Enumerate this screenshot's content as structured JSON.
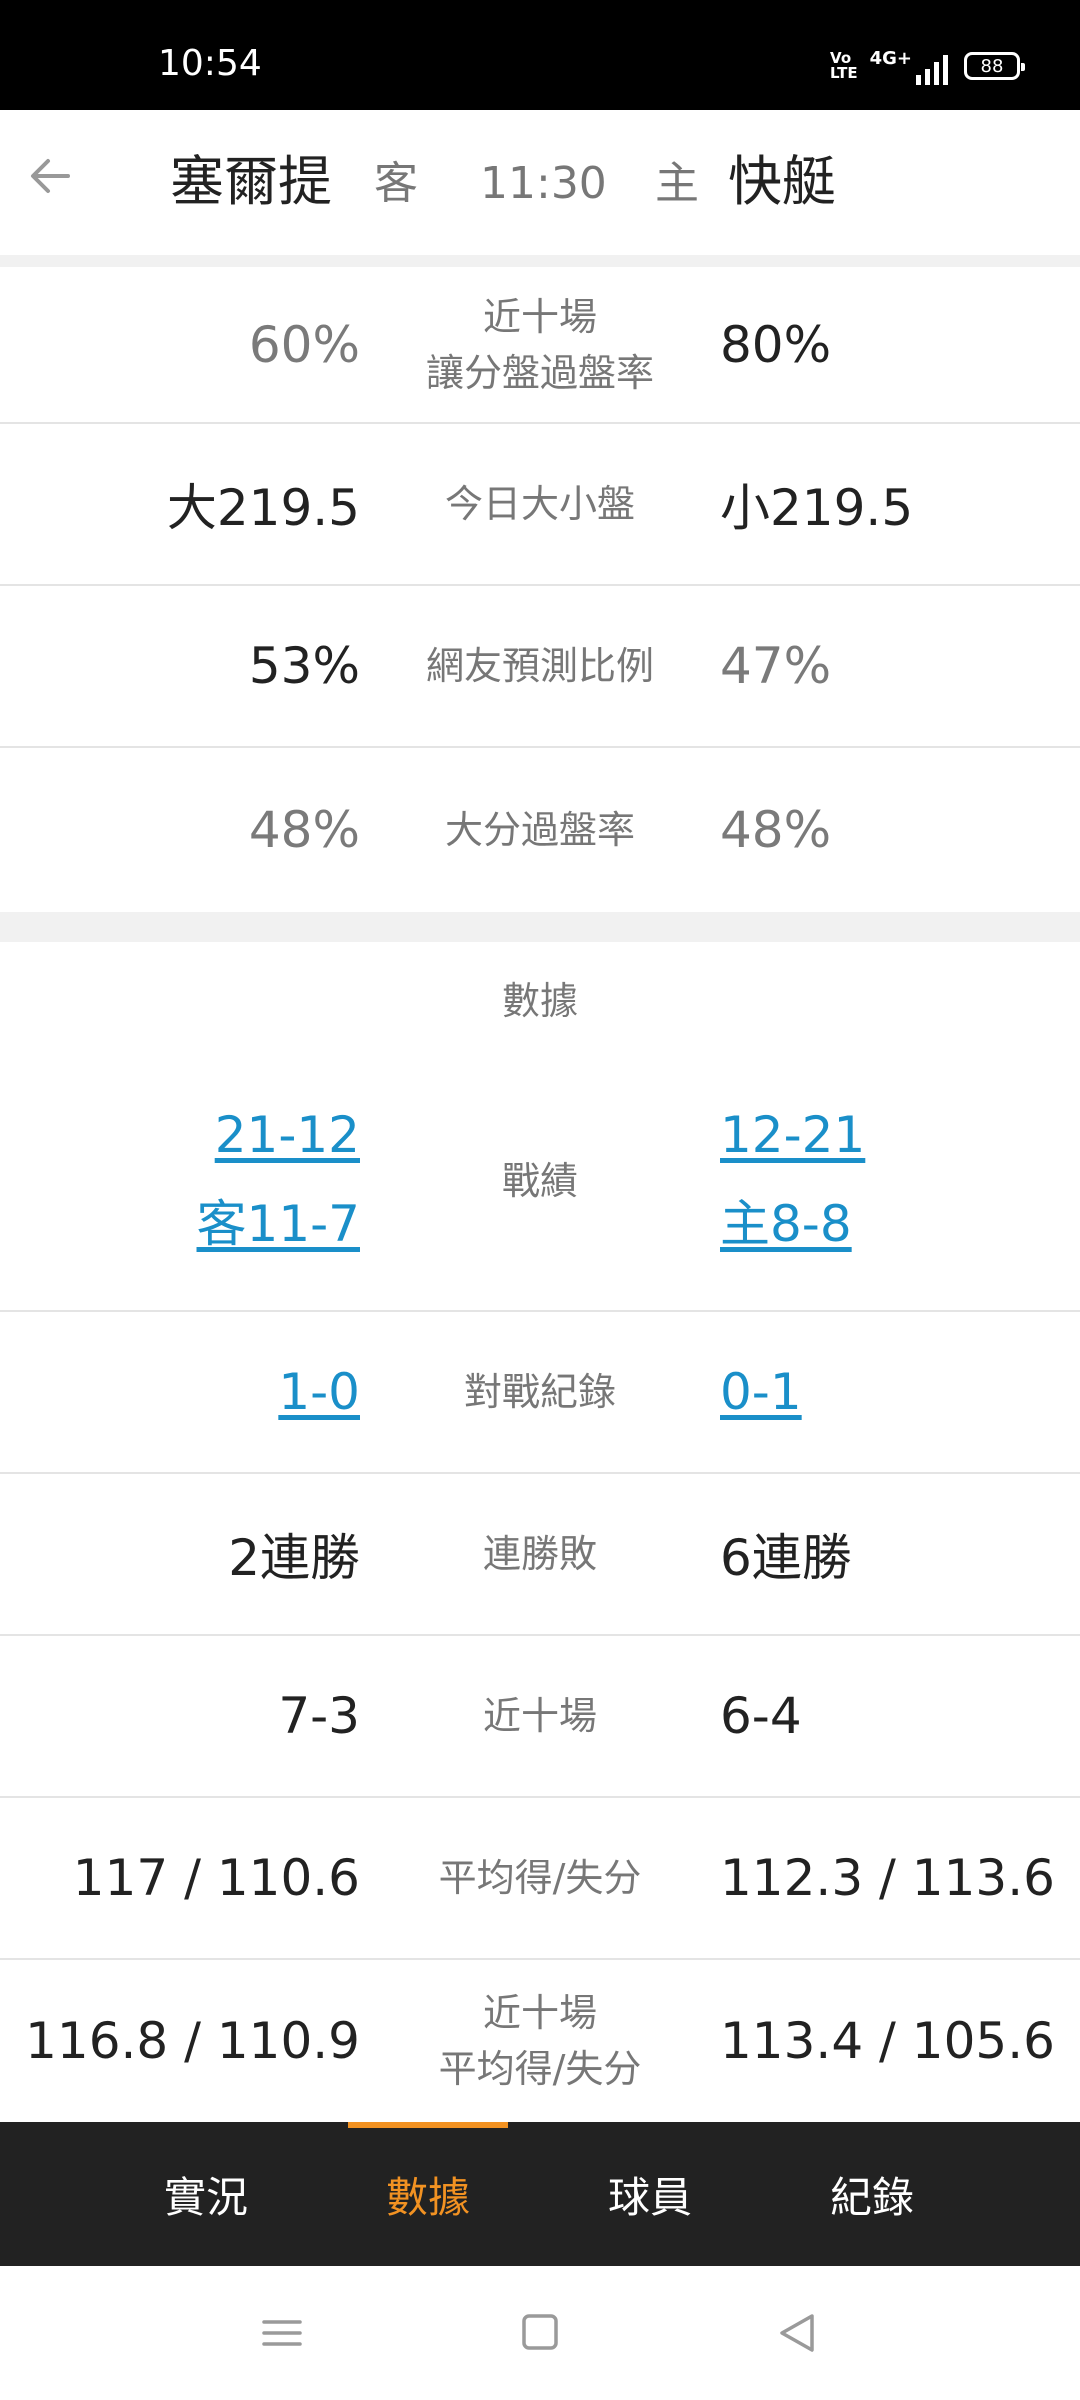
{
  "status_bar": {
    "time": "10:54",
    "volte_top": "Vo",
    "volte_bottom": "LTE",
    "network": "4G+",
    "battery": "88"
  },
  "header": {
    "away_team": "塞爾提",
    "away_tag": "客",
    "time": "11:30",
    "home_tag": "主",
    "home_team": "快艇"
  },
  "odds_rows": [
    {
      "left": "60%",
      "label_line1": "近十場",
      "label_line2": "讓分盤過盤率",
      "right": "80%"
    },
    {
      "left": "大219.5",
      "label": "今日大小盤",
      "right": "小219.5"
    },
    {
      "left": "53%",
      "label": "網友預測比例",
      "right": "47%"
    },
    {
      "left": "48%",
      "label": "大分過盤率",
      "right": "48%"
    }
  ],
  "stats_section": {
    "title": "數據",
    "record": {
      "label": "戰績",
      "left_line1": "21-12",
      "left_line2": "客11-7",
      "right_line1": "12-21",
      "right_line2": "主8-8"
    },
    "h2h": {
      "label": "對戰紀錄",
      "left": "1-0",
      "right": "0-1"
    },
    "streak": {
      "label": "連勝敗",
      "left": "2連勝",
      "right": "6連勝"
    },
    "last10": {
      "label": "近十場",
      "left": "7-3",
      "right": "6-4"
    },
    "avg": {
      "label": "平均得/失分",
      "left": "117 / 110.6",
      "right": "112.3 / 113.6"
    },
    "last10_avg": {
      "label_line1": "近十場",
      "label_line2": "平均得/失分",
      "left": "116.8 / 110.9",
      "right": "113.4 / 105.6"
    }
  },
  "tabs": [
    {
      "label": "實況"
    },
    {
      "label": "數據"
    },
    {
      "label": "球員"
    },
    {
      "label": "紀錄"
    }
  ],
  "active_tab": "數據",
  "colors": {
    "accent": "#f29222",
    "link": "#1a8fc9",
    "tabbar_bg": "#222222",
    "status_bg": "#000000"
  },
  "icons": [
    "back-arrow-icon",
    "menu-icon",
    "home-square-icon",
    "back-triangle-icon"
  ]
}
